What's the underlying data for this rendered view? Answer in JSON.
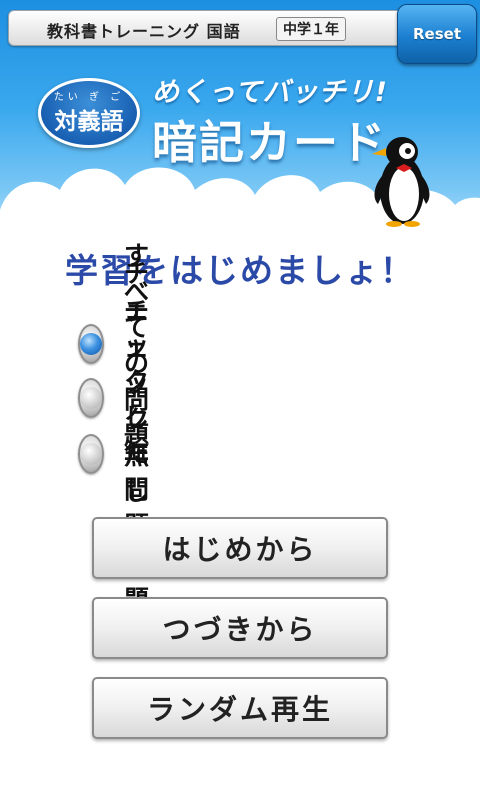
{
  "header": {
    "title": "教科書トレーニング 国語",
    "grade_tag": "中学１年",
    "reset_label": "Reset",
    "badge_ruby": "たい ぎ ご",
    "badge_text": "対義語",
    "catchphrase": "めくってバッチリ!",
    "card_title": "暗記カード"
  },
  "main": {
    "heading": "学習をはじめましょ！",
    "options": [
      {
        "label": "すべての問題",
        "selected": true
      },
      {
        "label": "チェックした問題",
        "selected": false
      },
      {
        "label": "チェック無しの問題",
        "selected": false
      }
    ],
    "buttons": {
      "start_label": "はじめから",
      "continue_label": "つづきから",
      "random_label": "ランダム再生"
    }
  },
  "colors": {
    "sky_top": "#1d8fe1",
    "heading_blue": "#2b4aa8",
    "reset_blue": "#1b7fd0",
    "radio_selected": "#3c91e0"
  },
  "icons": [
    "penguin-mascot-icon",
    "radio-selected-icon",
    "radio-unselected-icon"
  ]
}
